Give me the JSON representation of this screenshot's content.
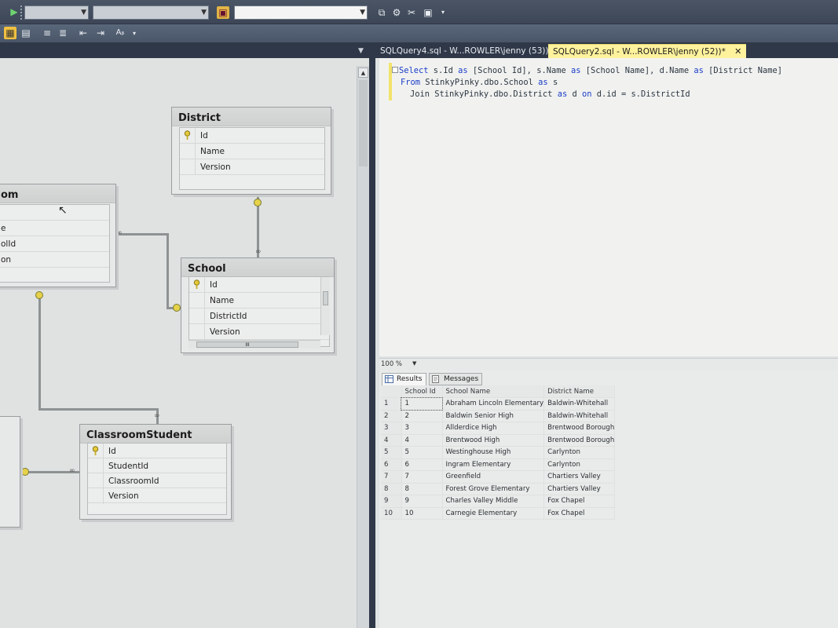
{
  "document_tabs": [
    {
      "label": "SQLQuery4.sql - W...ROWLER\\jenny (53))*",
      "active": false
    },
    {
      "label": "SQLQuery2.sql - W...ROWLER\\jenny (52))*",
      "active": true,
      "close": "✕"
    }
  ],
  "diagram": {
    "tables": {
      "district": {
        "title": "District",
        "columns": [
          "Id",
          "Name",
          "Version"
        ]
      },
      "school": {
        "title": "School",
        "columns": [
          "Id",
          "Name",
          "DistrictId",
          "Version"
        ]
      },
      "classroom_student": {
        "title": "ClassroomStudent",
        "columns": [
          "Id",
          "StudentId",
          "ClassroomId",
          "Version"
        ]
      },
      "classroom_partial": {
        "title": "om",
        "columns": [
          "e",
          "olId",
          "on"
        ]
      }
    },
    "school_hscroll_label": "III"
  },
  "editor": {
    "lines": [
      {
        "kw1": "Select",
        "rest1": " s.Id ",
        "kw2": "as",
        "rest2": " [School Id], s.Name ",
        "kw3": "as",
        "rest3": " [School Name], d.Name ",
        "kw4": "as",
        "rest4": " [District Name]"
      },
      {
        "kw1": "From",
        "rest1": " StinkyPinky.dbo.School ",
        "kw2": "as",
        "rest2": " s"
      },
      {
        "kw1": "Join",
        "rest1": " StinkyPinky.dbo.District ",
        "kw2": "as",
        "rest2": " d ",
        "kw3": "on",
        "rest3": " d.id = s.DistrictId"
      }
    ]
  },
  "zoom_bar": {
    "zoom": "100 %"
  },
  "results_tabs": {
    "results": "Results",
    "messages": "Messages"
  },
  "results": {
    "columns": [
      "School Id",
      "School Name",
      "District Name"
    ],
    "rows": [
      [
        "1",
        "1",
        "Abraham Lincoln Elementary",
        "Baldwin-Whitehall"
      ],
      [
        "2",
        "2",
        "Baldwin Senior High",
        "Baldwin-Whitehall"
      ],
      [
        "3",
        "3",
        "Allderdice High",
        "Brentwood Borough"
      ],
      [
        "4",
        "4",
        "Brentwood High",
        "Brentwood Borough"
      ],
      [
        "5",
        "5",
        "Westinghouse High",
        "Carlynton"
      ],
      [
        "6",
        "6",
        "Ingram Elementary",
        "Carlynton"
      ],
      [
        "7",
        "7",
        "Greenfield",
        "Chartiers Valley"
      ],
      [
        "8",
        "8",
        "Forest Grove Elementary",
        "Chartiers Valley"
      ],
      [
        "9",
        "9",
        "Charles Valley Middle",
        "Fox Chapel"
      ],
      [
        "10",
        "10",
        "Carnegie Elementary",
        "Fox Chapel"
      ]
    ]
  },
  "colors": {
    "active_tab": "#fff29d",
    "keyword": "#1a3cc8",
    "chrome": "#2f3848"
  }
}
